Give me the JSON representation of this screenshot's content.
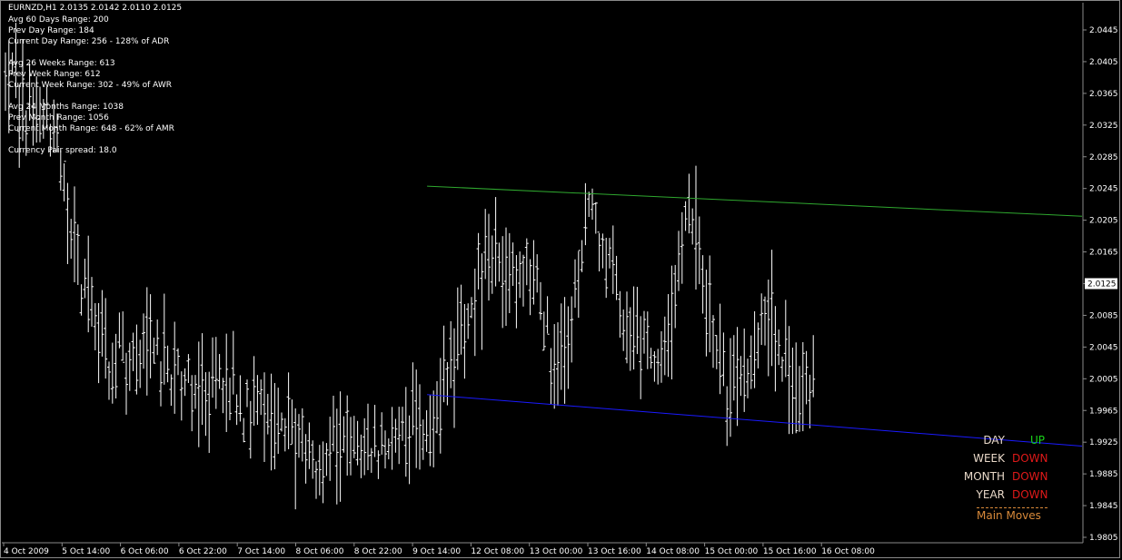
{
  "header": {
    "symbol_line": "EURNZD,H1  2.0135 2.0142 2.0110 2.0125"
  },
  "info_lines": [
    "Avg 60 Days Range: 200",
    "Prev Day Range: 184",
    "Current Day Range: 256 - 128% of ADR",
    "",
    "Avg 26 Weeks Range: 613",
    "Prev Week Range: 612",
    "Current Week Range: 302 - 49% of AWR",
    "",
    "Avg 24 Months Range: 1038",
    "Prev Month Range: 1056",
    "Current Month Range: 648 - 62% of AMR",
    "",
    "Currency Pair spread: 18.0"
  ],
  "trend_panel": {
    "rows": [
      {
        "label": "DAY",
        "value": "UP",
        "value_color": "#19d419"
      },
      {
        "label": "WEEK",
        "value": "DOWN",
        "value_color": "#e01919"
      },
      {
        "label": "MONTH",
        "value": "DOWN",
        "value_color": "#e01919"
      },
      {
        "label": "YEAR",
        "value": "DOWN",
        "value_color": "#e01919"
      }
    ],
    "label_color": "#e8d8c8",
    "footer": "Main Moves",
    "footer_color": "#d98a3a"
  },
  "colors": {
    "background": "#000000",
    "bars": "#ffffff",
    "upper_trendline": "#2fa82f",
    "lower_trendline": "#1a1aff",
    "axis_text": "#ffffff"
  },
  "chart_data": {
    "type": "ohlc",
    "symbol": "EURNZD",
    "timeframe": "H1",
    "current_price": "2.0125",
    "ylim": [
      1.9785,
      2.0465
    ],
    "y_ticks": [
      "2.0445",
      "2.0405",
      "2.0365",
      "2.0325",
      "2.0285",
      "2.0245",
      "2.0205",
      "2.0165",
      "2.0125",
      "2.0085",
      "2.0045",
      "2.0005",
      "1.9965",
      "1.9925",
      "1.9885",
      "1.9845",
      "1.9805"
    ],
    "x_ticks": [
      "4 Oct 2009",
      "5 Oct 14:00",
      "6 Oct 06:00",
      "6 Oct 22:00",
      "7 Oct 14:00",
      "8 Oct 06:00",
      "8 Oct 22:00",
      "9 Oct 14:00",
      "12 Oct 08:00",
      "13 Oct 00:00",
      "13 Oct 16:00",
      "14 Oct 08:00",
      "15 Oct 00:00",
      "15 Oct 16:00",
      "16 Oct 08:00"
    ],
    "bar_count": 235,
    "anchors": [
      [
        0,
        2.038
      ],
      [
        10,
        2.033
      ],
      [
        14,
        2.031
      ],
      [
        18,
        2.022
      ],
      [
        22,
        2.012
      ],
      [
        30,
        2.0035
      ],
      [
        40,
        2.004
      ],
      [
        50,
        2.0015
      ],
      [
        58,
        1.9995
      ],
      [
        62,
        2.001
      ],
      [
        70,
        1.996
      ],
      [
        80,
        1.9955
      ],
      [
        90,
        1.9905
      ],
      [
        100,
        1.9935
      ],
      [
        108,
        1.992
      ],
      [
        116,
        1.9935
      ],
      [
        124,
        1.9955
      ],
      [
        130,
        2.003
      ],
      [
        140,
        2.018
      ],
      [
        146,
        2.0125
      ],
      [
        152,
        2.015
      ],
      [
        160,
        1.9995
      ],
      [
        170,
        2.0225
      ],
      [
        180,
        2.008
      ],
      [
        190,
        2.0035
      ],
      [
        198,
        2.0205
      ],
      [
        210,
        1.9975
      ],
      [
        222,
        2.0075
      ],
      [
        230,
        1.9985
      ],
      [
        236,
        2.0035
      ],
      [
        244,
        2.0145
      ],
      [
        248,
        2.0125
      ]
    ],
    "trendlines": [
      {
        "name": "resistance",
        "from": [
          "9 Oct 14:00",
          2.0248
        ],
        "to_right_edge": 2.021
      },
      {
        "name": "support",
        "from": [
          "9 Oct 14:00",
          1.9985
        ],
        "to_right_edge": 1.992
      }
    ]
  }
}
